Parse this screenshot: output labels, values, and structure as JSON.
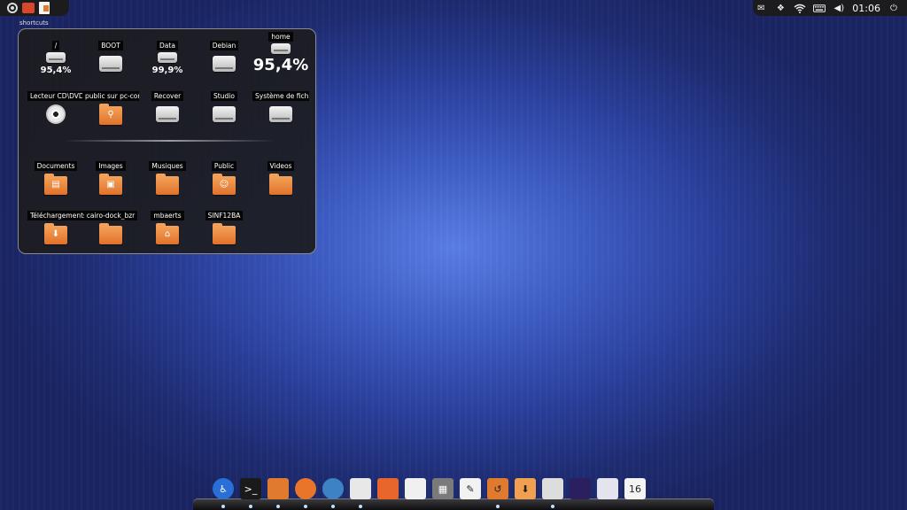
{
  "top_left": {
    "launcher_icons": [
      "ubuntu-icon",
      "folder-icon",
      "document-icon"
    ],
    "shortcut_label": "shortcuts"
  },
  "tray": {
    "icons": [
      "mail-icon",
      "dropbox-icon",
      "wifi-icon",
      "keyboard-icon",
      "volume-icon"
    ],
    "clock": "01:06",
    "power_icon": "power-icon"
  },
  "drives": [
    {
      "label": "/",
      "percent": "95,4%"
    },
    {
      "label": "BOOT",
      "percent": ""
    },
    {
      "label": "Data",
      "percent": "99,9%"
    },
    {
      "label": "Debian",
      "percent": ""
    },
    {
      "label": "home",
      "percent": "95,4%"
    }
  ],
  "drives_row2": [
    {
      "label": "Lecteur CD\\DVD",
      "icon": "disc-icon"
    },
    {
      "label": "public sur pc-com",
      "icon": "network-folder-icon"
    },
    {
      "label": "Recover",
      "icon": "drive-icon"
    },
    {
      "label": "Studio",
      "icon": "drive-icon"
    },
    {
      "label": "Système de fichie",
      "icon": "drive-icon"
    }
  ],
  "folders_row1": [
    {
      "label": "Documents",
      "glyph": "▤"
    },
    {
      "label": "Images",
      "glyph": "▣"
    },
    {
      "label": "Musiques",
      "glyph": ""
    },
    {
      "label": "Public",
      "glyph": "☺"
    },
    {
      "label": "Videos",
      "glyph": ""
    }
  ],
  "folders_row2": [
    {
      "label": "Téléchargements",
      "glyph": "⬇"
    },
    {
      "label": "cairo-dock_bzr",
      "glyph": ""
    },
    {
      "label": "mbaerts",
      "glyph": "⌂"
    },
    {
      "label": "SINF12BA",
      "glyph": ""
    }
  ],
  "dock": {
    "items": [
      {
        "name": "accessibility-icon",
        "glyph": "♿",
        "bg": "#2a6fd8"
      },
      {
        "name": "terminal-icon",
        "glyph": ">_",
        "bg": "#1a1a1a"
      },
      {
        "name": "file-manager-icon",
        "glyph": "",
        "bg": "#e07a2f"
      },
      {
        "name": "firefox-icon",
        "glyph": "",
        "bg": "#e8752a"
      },
      {
        "name": "thunderbird-icon",
        "glyph": "",
        "bg": "#3e82c6"
      },
      {
        "name": "chat-icon",
        "glyph": "",
        "bg": "#e8e8e8"
      },
      {
        "name": "software-center-icon",
        "glyph": "",
        "bg": "#e8662b"
      },
      {
        "name": "presentation-icon",
        "glyph": "",
        "bg": "#f0f0f0"
      },
      {
        "name": "calculator-icon",
        "glyph": "▦",
        "bg": "#7a7a7a"
      },
      {
        "name": "text-editor-icon",
        "glyph": "✎",
        "bg": "#f2f2f2"
      },
      {
        "name": "backup-icon",
        "glyph": "↺",
        "bg": "#e07a2f"
      },
      {
        "name": "download-folder-icon",
        "glyph": "⬇",
        "bg": "#f0a050"
      },
      {
        "name": "qr-code-icon",
        "glyph": "",
        "bg": "#dddddd"
      },
      {
        "name": "desklet-icon",
        "glyph": "",
        "bg": "#2a2060"
      },
      {
        "name": "window-icon",
        "glyph": "",
        "bg": "#e4e4ee"
      },
      {
        "name": "calendar-icon",
        "glyph": "16",
        "bg": "#f4f4f4"
      }
    ]
  }
}
